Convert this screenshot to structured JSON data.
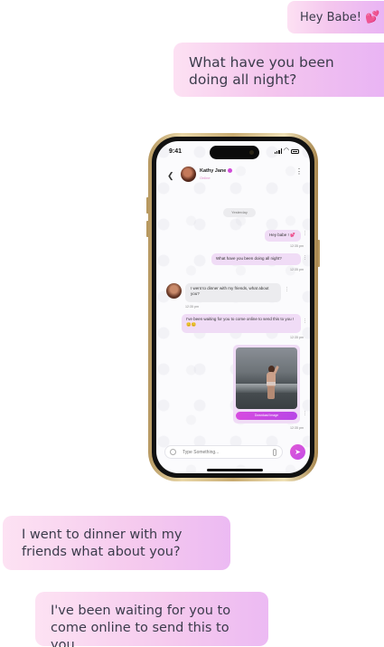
{
  "outer_bubbles": {
    "top1": "Hey Babe! 💕",
    "top2": "What have you been doing all night?",
    "bottom1": "I went to dinner with my friends what about you?",
    "bottom2": "I've been waiting for you to come online to send this to you.."
  },
  "phone": {
    "status_time": "9:41",
    "contact": {
      "name": "Kathy Jane",
      "status": "Online"
    },
    "date_chip": "Yesterday",
    "messages": [
      {
        "text": "Hey babe ! 💕",
        "time": "12:35 pm"
      },
      {
        "text": "What have you been doing all night?",
        "time": "12:35 pm"
      },
      {
        "text": "I went to dinner with my friends, what about you?",
        "time": "12:35 pm"
      },
      {
        "text": "I've been waiting for you to come online to send this to you ! 😊😊",
        "time": "12:35 pm"
      },
      {
        "text": "Download Image",
        "time": "12:35 pm"
      }
    ],
    "input_placeholder": "Type Something...",
    "icons": {
      "back": "back-arrow-icon",
      "menu": "more-vertical-icon",
      "emoji": "smile-icon",
      "attach": "paperclip-icon",
      "send": "send-icon"
    }
  },
  "colors": {
    "accent": "#d04bd8",
    "bubble_out": "#f0dcf6",
    "bubble_in": "#ececef"
  }
}
